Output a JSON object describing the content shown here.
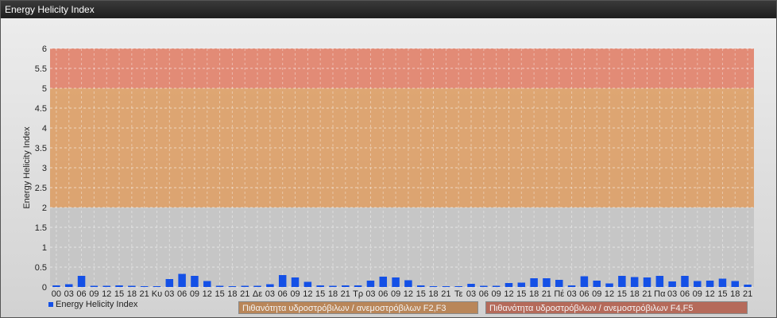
{
  "window": {
    "title": "Energy Helicity Index"
  },
  "legend": {
    "series_label": "Energy Helicity Index"
  },
  "bands": [
    {
      "label": "Πιθανότητα υδροστρόβιλων / ανεμοστρόβιλων F2,F3",
      "range": [
        2,
        5
      ],
      "color": "#dc9a5e"
    },
    {
      "label": "Πιθανότητα υδροστρόβιλων / ανεμοστρόβιλων F4,F5",
      "range": [
        5,
        6
      ],
      "color": "#e07a62"
    }
  ],
  "colors": {
    "bar": "#1450e6",
    "low_band": "#c6c6c6"
  },
  "chart_data": {
    "type": "bar",
    "ylabel": "Energy Helicity Index",
    "ylim": [
      0,
      6
    ],
    "yticks": [
      0,
      0.5,
      1,
      1.5,
      2,
      2.5,
      3,
      3.5,
      4,
      4.5,
      5,
      5.5,
      6
    ],
    "grid": true,
    "categories": [
      "00",
      "03",
      "06",
      "09",
      "12",
      "15",
      "18",
      "21",
      "Κυ",
      "03",
      "06",
      "09",
      "12",
      "15",
      "18",
      "21",
      "Δε",
      "03",
      "06",
      "09",
      "12",
      "15",
      "18",
      "21",
      "Τρ",
      "03",
      "06",
      "09",
      "12",
      "15",
      "18",
      "21",
      "Τε",
      "03",
      "06",
      "09",
      "12",
      "15",
      "18",
      "21",
      "Πέ",
      "03",
      "06",
      "09",
      "12",
      "15",
      "18",
      "21",
      "Πα",
      "03",
      "06",
      "09",
      "12",
      "15",
      "18",
      "21"
    ],
    "series": [
      {
        "name": "Energy Helicity Index",
        "values": [
          0.04,
          0.07,
          0.28,
          0.03,
          0.03,
          0.04,
          0.03,
          0.02,
          0.02,
          0.2,
          0.33,
          0.28,
          0.15,
          0.03,
          0.02,
          0.03,
          0.03,
          0.07,
          0.3,
          0.24,
          0.13,
          0.04,
          0.03,
          0.04,
          0.04,
          0.16,
          0.26,
          0.24,
          0.17,
          0.04,
          0.02,
          0.02,
          0.02,
          0.08,
          0.03,
          0.03,
          0.1,
          0.11,
          0.22,
          0.22,
          0.18,
          0.04,
          0.27,
          0.16,
          0.09,
          0.28,
          0.25,
          0.24,
          0.28,
          0.14,
          0.28,
          0.15,
          0.16,
          0.21,
          0.15,
          0.06
        ]
      }
    ]
  }
}
